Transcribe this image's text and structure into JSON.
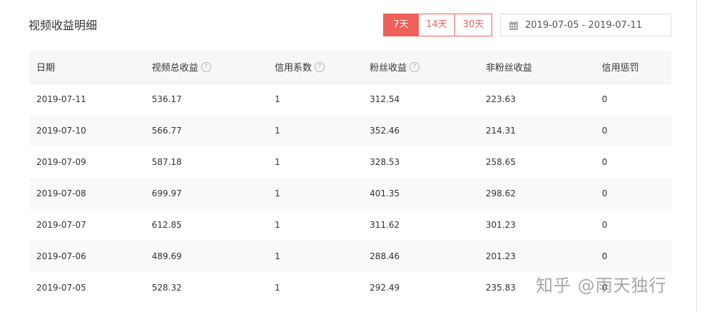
{
  "page": {
    "title": "视频收益明细"
  },
  "range_buttons": [
    {
      "label": "7天",
      "active": true
    },
    {
      "label": "14天",
      "active": false
    },
    {
      "label": "30天",
      "active": false
    }
  ],
  "date_range": {
    "value": "2019-07-05 - 2019-07-11",
    "icon": "calendar-icon"
  },
  "table": {
    "headers": [
      {
        "label": "日期",
        "help": false
      },
      {
        "label": "视频总收益",
        "help": true
      },
      {
        "label": "信用系数",
        "help": true
      },
      {
        "label": "粉丝收益",
        "help": true
      },
      {
        "label": "非粉丝收益",
        "help": false
      },
      {
        "label": "信用惩罚",
        "help": false
      }
    ],
    "rows": [
      [
        "2019-07-11",
        "536.17",
        "1",
        "312.54",
        "223.63",
        "0"
      ],
      [
        "2019-07-10",
        "566.77",
        "1",
        "352.46",
        "214.31",
        "0"
      ],
      [
        "2019-07-09",
        "587.18",
        "1",
        "328.53",
        "258.65",
        "0"
      ],
      [
        "2019-07-08",
        "699.97",
        "1",
        "401.35",
        "298.62",
        "0"
      ],
      [
        "2019-07-07",
        "612.85",
        "1",
        "311.62",
        "301.23",
        "0"
      ],
      [
        "2019-07-06",
        "489.69",
        "1",
        "288.46",
        "201.23",
        "0"
      ],
      [
        "2019-07-05",
        "528.32",
        "1",
        "292.49",
        "235.83",
        "0"
      ]
    ]
  },
  "help_icon_glyph": "?",
  "watermark": "知乎 @雨天独行",
  "colors": {
    "accent": "#f0605a",
    "header_bg": "#f7f7f7",
    "stripe_bg": "#f9f9f9"
  }
}
